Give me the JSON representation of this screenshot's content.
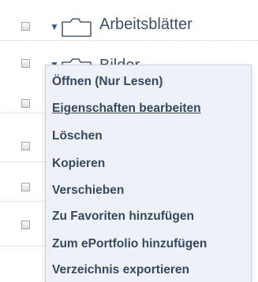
{
  "tree": {
    "rows": [
      {
        "label": "Arbeitsblätter",
        "expanded": true
      },
      {
        "label": "Bilder",
        "expanded": true
      }
    ]
  },
  "context_menu": {
    "items": [
      {
        "label": "Öffnen (Nur Lesen)"
      },
      {
        "label": "Eigenschaften bearbeiten",
        "hovered": true
      },
      {
        "label": "Löschen"
      },
      {
        "label": "Kopieren"
      },
      {
        "label": "Verschieben"
      },
      {
        "label": "Zu Favoriten hinzufügen"
      },
      {
        "label": "Zum ePortfolio hinzufügen"
      },
      {
        "label": "Verzeichnis exportieren"
      }
    ]
  },
  "colors": {
    "folder_label": "#3d4f63",
    "menu_text": "#36485c",
    "menu_bg": "#eef2f8",
    "caret": "#3a5a8c"
  }
}
